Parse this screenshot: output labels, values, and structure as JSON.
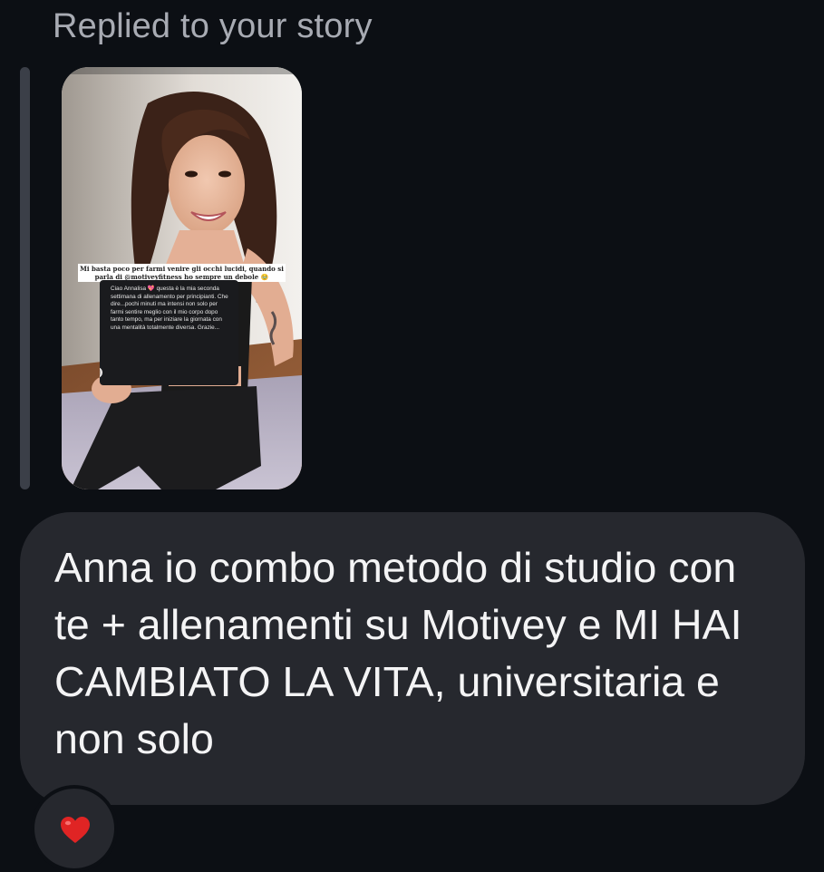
{
  "header": {
    "reply_label": "Replied to your story"
  },
  "story": {
    "caption": "Mi basta poco per farmi venire gli occhi lucidi, quando si parla di @motiveyfitness ho sempre un debole 🥹",
    "quote": "Ciao Annalisa 💖 questa è la mia seconda settimana di allenamento per principianti. Che dire...pochi minuti ma intensi non solo per farmi sentire meglio con il mio corpo dopo tanto tempo, ma per iniziare la giornata con una mentalità totalmente diversa. Grazie..."
  },
  "message": {
    "text": "Anna io combo metodo di studio con te + allenamenti su Motivey e MI HAI CAMBIATO LA VITA, universitaria e non solo"
  },
  "reaction": {
    "icon": "heart-icon",
    "color": "#e02424"
  },
  "colors": {
    "background": "#0c0f14",
    "bubble": "#26282e",
    "label": "#a8abb3",
    "text": "#f4f4f5"
  }
}
